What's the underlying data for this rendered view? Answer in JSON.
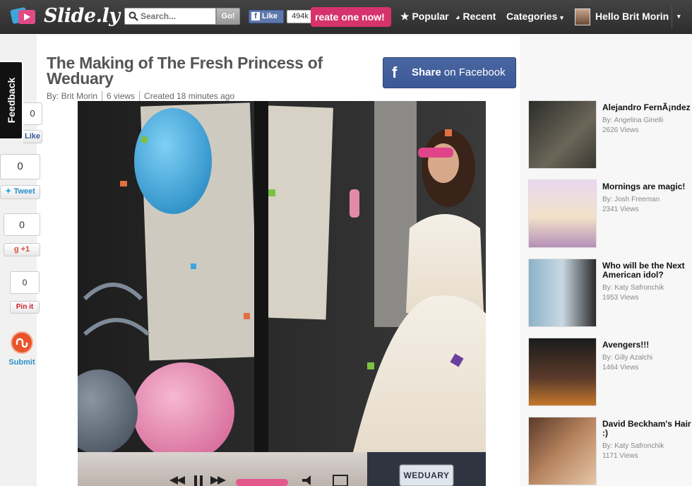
{
  "header": {
    "logo_text": "Slide.ly",
    "search_placeholder": "Search...",
    "search_go_label": "Go!",
    "fb_like_label": "Like",
    "fb_like_count": "494k",
    "create_label": "reate one now!",
    "nav_popular": "Popular",
    "nav_recent": "Recent",
    "nav_categories": "Categories",
    "user_greeting": "Hello Brit Morin"
  },
  "feedback_tab": "Feedback",
  "share_column": {
    "like_count": "0",
    "like_label": "Like",
    "tweet_count": "0",
    "tweet_label": "Tweet",
    "gplus_count": "0",
    "gplus_label": "+1",
    "pin_count": "0",
    "pin_label": "Pin it",
    "stumble_label": "Submit"
  },
  "main": {
    "title": "The Making of The Fresh Princess of Weduary",
    "author": "By: Brit Morin",
    "views": "6 views",
    "created": "Created 18 minutes ago",
    "share_facebook_bold": "Share",
    "share_facebook_rest": " on Facebook",
    "thumb_plate": "WEDUARY"
  },
  "sidebar": {
    "items": [
      {
        "title": "Alejandro FernÃ¡ndez",
        "author": "By: Angelina Ginelli",
        "views": "2626 Views"
      },
      {
        "title": "Mornings are magic!",
        "author": "By: Josh Freeman",
        "views": "2341 Views"
      },
      {
        "title": "Who will be the Next American idol?",
        "author": "By: Katy Safronchik",
        "views": "1953 Views"
      },
      {
        "title": "Avengers!!!",
        "author": "By: Gilly Azalchi",
        "views": "1464 Views"
      },
      {
        "title": "David Beckham's Hair :)",
        "author": "By: Katy Safronchik",
        "views": "1171 Views"
      }
    ]
  },
  "colors": {
    "topbar": "#333333",
    "create_button": "#d6336c",
    "facebook_blue": "#3b5998"
  }
}
